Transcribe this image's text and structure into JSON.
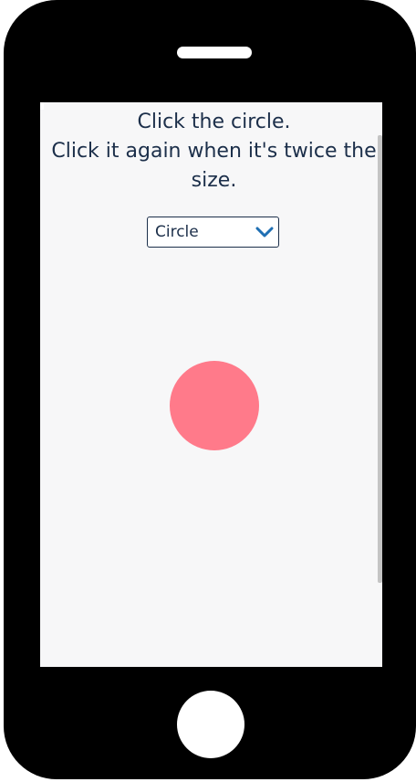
{
  "instructions": {
    "line1": "Click the circle.",
    "line2": "Click it again when it's twice the size."
  },
  "shape_select": {
    "selected": "Circle"
  },
  "target": {
    "shape": "circle",
    "color": "#ff7a8a"
  },
  "colors": {
    "text": "#1c2f4a",
    "screen_bg": "#f7f7f8",
    "phone_body": "#000000"
  },
  "icons": {
    "dropdown": "chevron-down-icon"
  }
}
